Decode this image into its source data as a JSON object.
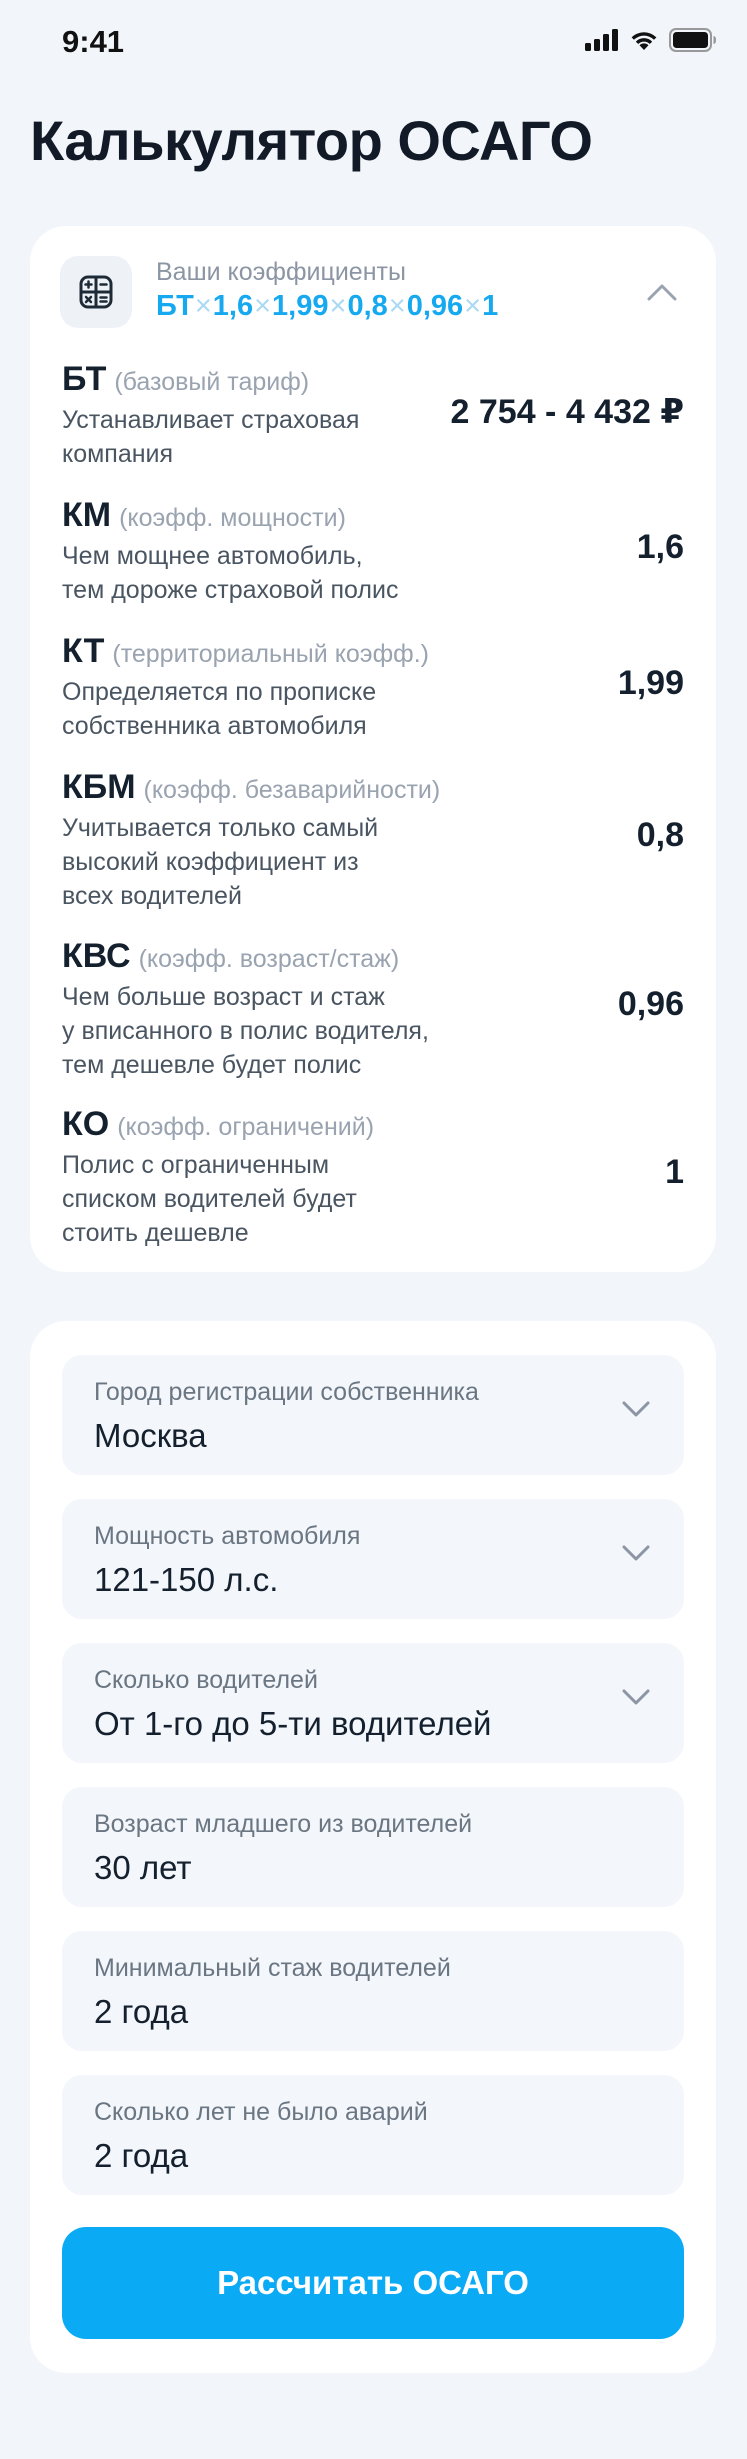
{
  "status_bar": {
    "time": "9:41"
  },
  "page": {
    "title": "Калькулятор ОСАГО"
  },
  "coefficients": {
    "caption": "Ваши коэффициенты",
    "formula": [
      "БТ",
      "1,6",
      "1,99",
      "0,8",
      "0,96",
      "1"
    ],
    "separator": "×",
    "items": [
      {
        "code": "БТ",
        "hint": "(базовый тариф)",
        "desc": [
          "Устанавливает страховая",
          "компания"
        ],
        "value": "2 754 - 4 432 ₽"
      },
      {
        "code": "КМ",
        "hint": "(коэфф. мощности)",
        "desc": [
          "Чем мощнее автомобиль,",
          "тем дороже страховой полис"
        ],
        "value": "1,6"
      },
      {
        "code": "КТ",
        "hint": "(территориальный коэфф.)",
        "desc": [
          "Определяется по прописке",
          "собственника автомобиля"
        ],
        "value": "1,99"
      },
      {
        "code": "КБМ",
        "hint": "(коэфф. безаварийности)",
        "desc": [
          "Учитывается только самый",
          "высокий коэффициент из",
          "всех водителей"
        ],
        "value": "0,8"
      },
      {
        "code": "КВС",
        "hint": "(коэфф. возраст/стаж)",
        "desc": [
          "Чем больше возраст и стаж",
          "у вписанного в полис водителя,",
          "тем дешевле будет полис"
        ],
        "value": "0,96"
      },
      {
        "code": "КО",
        "hint": "(коэфф. ограничений)",
        "desc": [
          "Полис с ограниченным",
          "списком водителей будет",
          "стоить дешевле"
        ],
        "value": "1"
      }
    ]
  },
  "form": {
    "fields": [
      {
        "label": "Город регистрации собственника",
        "value": "Москва",
        "dropdown": true
      },
      {
        "label": "Мощность автомобиля",
        "value": "121-150 л.с.",
        "dropdown": true
      },
      {
        "label": "Сколько водителей",
        "value": "От 1-го до 5-ти водителей",
        "dropdown": true
      },
      {
        "label": "Возраст младшего из водителей",
        "value": "30 лет",
        "dropdown": false
      },
      {
        "label": "Минимальный стаж водителей",
        "value": "2 года",
        "dropdown": false
      },
      {
        "label": "Сколько лет не было аварий",
        "value": "2 года",
        "dropdown": false
      }
    ],
    "submit_label": "Рассчитать ОСАГО"
  },
  "colors": {
    "accent": "#0aaaf5",
    "formula": "#17a9f0",
    "background": "#f2f5f9"
  }
}
